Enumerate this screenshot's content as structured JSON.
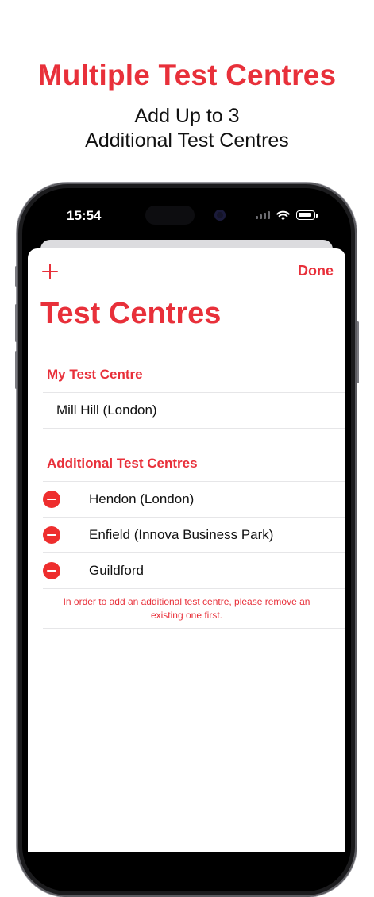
{
  "marketing": {
    "headline": "Multiple Test Centres",
    "subline_1": "Add Up to 3",
    "subline_2": "Additional Test Centres"
  },
  "status_bar": {
    "time": "15:54",
    "icons": [
      "cellular-signal-icon",
      "wifi-icon",
      "battery-icon"
    ]
  },
  "nav": {
    "add_icon": "plus-icon",
    "done_label": "Done"
  },
  "page_title": "Test Centres",
  "my_section": {
    "header": "My Test Centre",
    "items": [
      "Mill Hill (London)"
    ]
  },
  "additional_section": {
    "header": "Additional Test Centres",
    "items": [
      "Hendon (London)",
      "Enfield (Innova Business Park)",
      "Guildford"
    ]
  },
  "footer_note": "In order to add an additional test centre, please remove an existing one first.",
  "colors": {
    "accent": "#E8303A",
    "delete": "#EE2E2E",
    "separator": "#e6e6e8"
  }
}
